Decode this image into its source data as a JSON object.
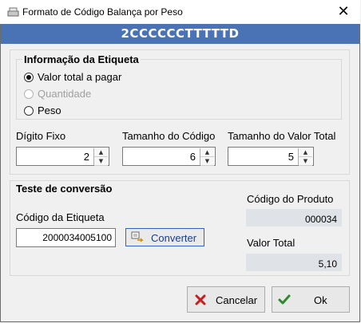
{
  "window": {
    "title": "Formato de Código Balança por Peso"
  },
  "header": {
    "code": "2CCCCCCTTTTTD"
  },
  "etiqueta": {
    "title": "Informação da Etiqueta",
    "options": [
      {
        "label": "Valor total a pagar",
        "checked": true,
        "disabled": false
      },
      {
        "label": "Quantidade",
        "checked": false,
        "disabled": true
      },
      {
        "label": "Peso",
        "checked": false,
        "disabled": false
      }
    ]
  },
  "fields": {
    "digito_fixo": {
      "label": "Dígito Fixo",
      "value": "2"
    },
    "tamanho_codigo": {
      "label": "Tamanho do Código",
      "value": "6"
    },
    "tamanho_valor": {
      "label": "Tamanho do Valor Total",
      "value": "5"
    }
  },
  "teste": {
    "title": "Teste de conversão",
    "codigo_etiqueta_label": "Código da Etiqueta",
    "codigo_etiqueta_value": "2000034005100",
    "converter_label": "Converter",
    "codigo_produto_label": "Código do Produto",
    "codigo_produto_value": "000034",
    "valor_total_label": "Valor Total",
    "valor_total_value": "5,10"
  },
  "buttons": {
    "cancel": "Cancelar",
    "ok": "Ok"
  },
  "icons": {
    "app": "scale-icon",
    "close": "close-icon",
    "converter": "convert-icon",
    "cancel": "x-icon",
    "ok": "check-icon"
  }
}
